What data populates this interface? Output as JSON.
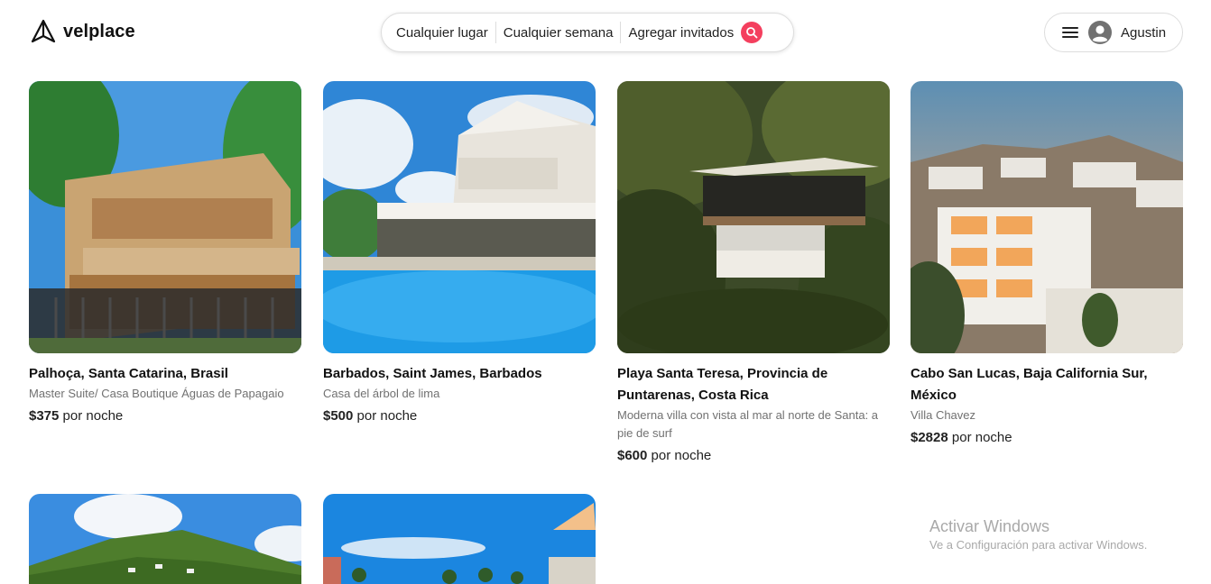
{
  "brand": {
    "name": "velplace",
    "logo_icon": "triangle-logo-icon"
  },
  "search": {
    "location_label": "Cualquier lugar",
    "week_label": "Cualquier semana",
    "guests_label": "Agregar invitados",
    "button_icon": "search-icon",
    "accent_color": "#f43f5e"
  },
  "user_menu": {
    "menu_icon": "hamburger-menu-icon",
    "avatar_icon": "user-avatar-icon",
    "name": "Agustin"
  },
  "listings": [
    {
      "title": "Palhoça, Santa Catarina, Brasil",
      "subtitle": "Master Suite/ Casa Boutique Águas de Papagaio",
      "price": "$375",
      "price_suffix": "por noche"
    },
    {
      "title": "Barbados, Saint James, Barbados",
      "subtitle": "Casa del árbol de lima",
      "price": "$500",
      "price_suffix": "por noche"
    },
    {
      "title": "Playa Santa Teresa, Provincia de Puntarenas, Costa Rica",
      "subtitle": "Moderna villa con vista al mar al norte de Santa: a pie de surf",
      "price": "$600",
      "price_suffix": "por noche"
    },
    {
      "title": "Cabo San Lucas, Baja California Sur, México",
      "subtitle": "Villa Chavez",
      "price": "$2828",
      "price_suffix": "por noche"
    }
  ],
  "watermark": {
    "title": "Activar Windows",
    "subtitle": "Ve a Configuración para activar Windows."
  }
}
